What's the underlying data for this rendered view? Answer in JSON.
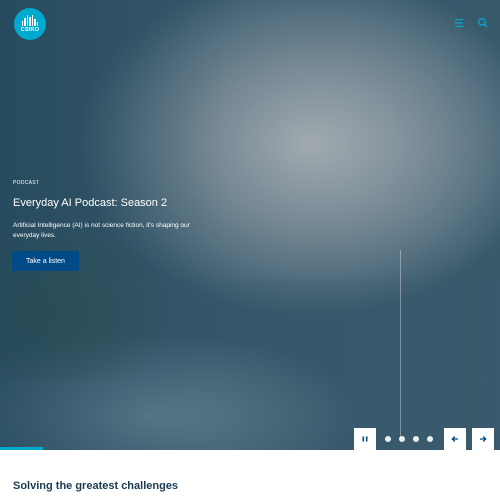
{
  "brand": {
    "logo_text": "CSIRO",
    "accent_color": "#00a9ce",
    "button_color": "#004b87"
  },
  "header": {
    "icons": [
      "menu-icon",
      "search-icon"
    ]
  },
  "hero": {
    "eyebrow": "PODCAST",
    "title": "Everyday AI Podcast: Season 2",
    "description": "Artificial Intelligence (AI) is not science fiction, it's shaping our everyday lives.",
    "cta_label": "Take a listen"
  },
  "carousel": {
    "slide_count": 4,
    "controls": [
      "pause-icon",
      "arrow-left-icon",
      "arrow-right-icon"
    ]
  },
  "main": {
    "section_title": "Solving the greatest challenges"
  }
}
